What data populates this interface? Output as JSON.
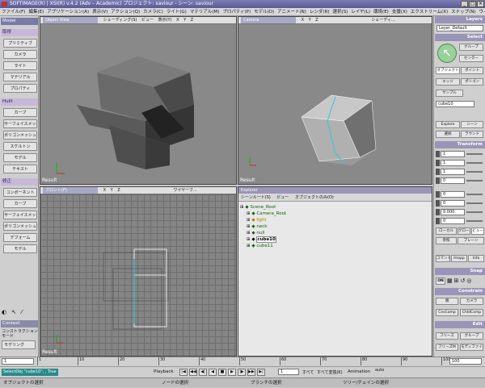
{
  "window": {
    "title": "SOFTIMAGE(R) | XSI(R) v.4.2 (Adv – Academic) プロジェクト: saviour - シーン: saviour",
    "minimize": "_",
    "maximize": "□",
    "close": "×"
  },
  "menu": [
    "ファイル(F)",
    "編集(E)",
    "アプリケーション(A)",
    "表示(V)",
    "アクション(Q)",
    "カメラ(C)",
    "ライト(G)",
    "マテリアル(M)",
    "プロパティ(P)",
    "モデル(D)",
    "アニメート(N)",
    "レンダ(R)",
    "選択(S)",
    "レイヤ(L)",
    "環境(E)",
    "支援(X)",
    "エクストリーム(X)",
    "スナップ(N)",
    "ウィンドウ(W)",
    "ヘルプ(H)"
  ],
  "left_panel": {
    "model_header": "Model",
    "get_header": "取得",
    "get_items": [
      "プリミティブ",
      "カメラ",
      "ライト",
      "マテリアル",
      "プロパティ"
    ],
    "mod_header": "Hullt",
    "create_items": [
      "カーブ",
      "サーフェイスメッシュ",
      "ポリゴンメッシュ",
      "スケルトン",
      "モデル",
      "テキスト"
    ],
    "modify_header": "修正",
    "modify_items": [
      "コンポーネント",
      "カーブ",
      "サーフェイスメッシュ",
      "ポリゴンメッシュ",
      "デフォーム",
      "モデル"
    ],
    "context_header": "Context",
    "context_label": "コンストラクションモード",
    "context_value": "モデリング"
  },
  "viewports": {
    "top_left": {
      "title": "Object View",
      "menus": [
        "シェーディング(S)",
        "ビュー",
        "表示(Y)"
      ],
      "axes": [
        "X",
        "Y",
        "Z"
      ],
      "label": "Result"
    },
    "top_right": {
      "title": "Camera",
      "menus": [
        "X",
        "Y",
        "Z"
      ],
      "extra": "シェーディ...",
      "label": "Result"
    },
    "bottom_left": {
      "title": "フロント(F)",
      "menus": [
        "X",
        "Y",
        "Z"
      ],
      "extra": "ワイヤーフ...",
      "label": "Result"
    }
  },
  "explorer": {
    "title": "Explorer",
    "toolbar": [
      "シーンルート(S)",
      "ビュー",
      "オブジェクトのみ(O)"
    ],
    "tree": [
      {
        "label": "Scene_Root",
        "color": "#106010",
        "indent": 0,
        "icon": "scene-root-icon"
      },
      {
        "label": "Camera_Root",
        "color": "#106010",
        "indent": 1,
        "icon": "camera-icon"
      },
      {
        "label": "light",
        "color": "#a08000",
        "indent": 1,
        "icon": "light-icon"
      },
      {
        "label": "neck",
        "color": "#106010",
        "indent": 1,
        "icon": "null-icon"
      },
      {
        "label": "null",
        "color": "#106010",
        "indent": 1,
        "icon": "null-icon"
      },
      {
        "label": "cube10",
        "color": "#000000",
        "indent": 1,
        "icon": "polymesh-icon",
        "selected": true
      },
      {
        "label": "cube11",
        "color": "#106010",
        "indent": 1,
        "icon": "polymesh-icon"
      }
    ]
  },
  "right_panel": {
    "layers_header": "Layers",
    "layer_default": "Layer_Default",
    "select_header": "Select",
    "select_buttons": [
      "グループ",
      "センター",
      "オブジェクト",
      "ポイント",
      "エッジ",
      "ポリゴン",
      "サンプル"
    ],
    "selection_name": "cube10",
    "select_misc": [
      "Explore",
      "シーン",
      "選択",
      "ラウンド"
    ],
    "transform_header": "Transform",
    "transform_values": [
      "1",
      "1",
      "1",
      "0",
      "0",
      "0",
      "0.000",
      "0"
    ],
    "transform_buttons": [
      "ローカル",
      "グローバル",
      "ビュー",
      "参照",
      "プレーン",
      "コマンド",
      "Hropp",
      "Info"
    ],
    "snap_header": "Snap",
    "snap_on": "ON",
    "constrain_header": "Constrain",
    "constrain_buttons": [
      "親",
      "カメラ",
      "CnsComp",
      "ChldComp"
    ],
    "edit_header": "Edit",
    "edit_buttons": [
      "フリーズ",
      "グループ",
      "フリーズM",
      "モディファイ"
    ]
  },
  "timeline": {
    "start": "1",
    "end": "100",
    "ticks": [
      "1",
      "10",
      "20",
      "30",
      "40",
      "50",
      "60",
      "70",
      "80",
      "90",
      "100"
    ]
  },
  "status": {
    "command": "SelectObj \"cube10\", , True",
    "playback": "Playback",
    "frame": "1",
    "all_label": "すべて",
    "all_keys": "すべて変換(K)",
    "animation": "Animation",
    "auto": "auto"
  },
  "footer": {
    "hint1": "オブジェクトの選択",
    "hint2": "ノードの選択",
    "hint3": "ブランチの選択",
    "hint4": "ツリー/チェインの選択"
  },
  "colors": {
    "title_bar": "#6a6aa8",
    "header_purple": "#9a94b8",
    "viewport_bg": "#898989",
    "selection_cyan": "#30c8d8"
  }
}
